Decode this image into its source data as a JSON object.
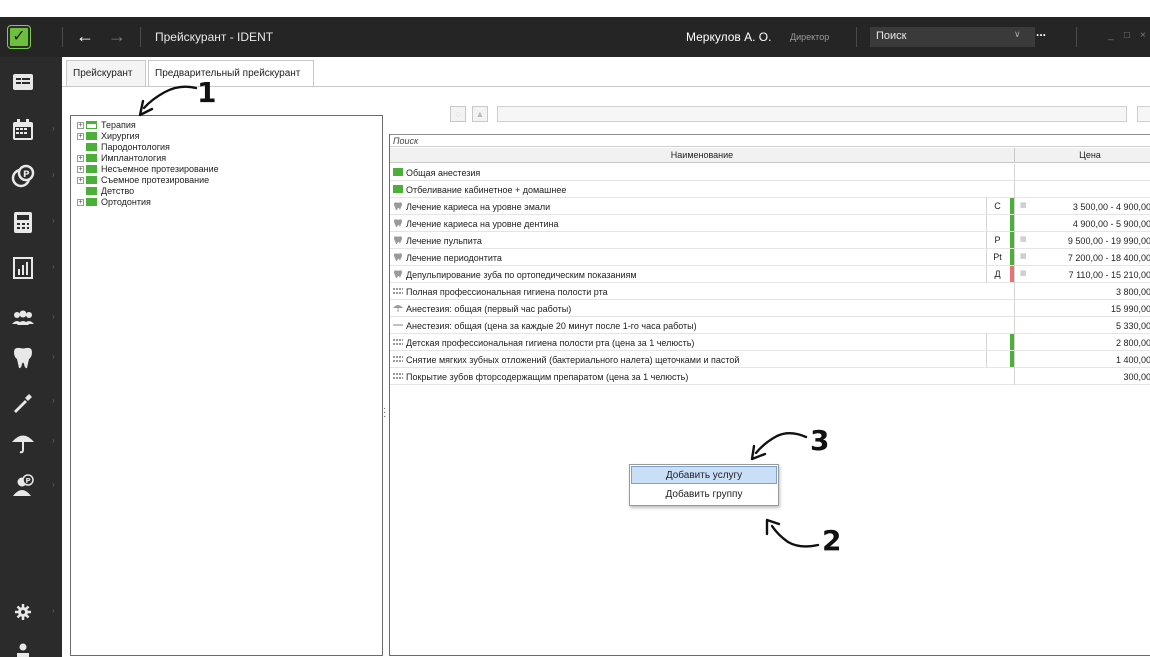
{
  "titlebar": {
    "title": "Прейскурант - IDENT",
    "user_name": "Меркулов А. О.",
    "user_role": "Директор",
    "search_value": "Поиск",
    "more": "...",
    "minimize": "_",
    "maximize": "□",
    "close": "×"
  },
  "sidebar": {
    "items": [
      "registry-icon",
      "calendar-icon",
      "finance-icon",
      "calculator-icon",
      "reports-icon",
      "patients-icon",
      "tooth-icon",
      "tools-icon",
      "umbrella-icon",
      "admin-icon"
    ],
    "bottom": [
      "settings-icon",
      "user-icon"
    ]
  },
  "tabs": [
    {
      "label": "Прейскурант",
      "active": false
    },
    {
      "label": "Предварительный прейскурант",
      "active": true
    }
  ],
  "tree": [
    {
      "label": "Терапия",
      "expander": "+",
      "open": true
    },
    {
      "label": "Хирургия",
      "expander": "+",
      "open": false
    },
    {
      "label": "Пародонтология",
      "expander": "",
      "open": false
    },
    {
      "label": "Имплантология",
      "expander": "+",
      "open": false
    },
    {
      "label": "Несъемное протезирование",
      "expander": "+",
      "open": false
    },
    {
      "label": "Съемное протезирование",
      "expander": "+",
      "open": false
    },
    {
      "label": "Детство",
      "expander": "",
      "open": false
    },
    {
      "label": "Ортодонтия",
      "expander": "+",
      "open": false
    }
  ],
  "list": {
    "search_placeholder": "Поиск",
    "col_name": "Наименование",
    "col_price": "Цена",
    "rows": [
      {
        "icon": "folder",
        "name": "Общая анестезия",
        "code": "",
        "bar": "",
        "price": ""
      },
      {
        "icon": "folder",
        "name": "Отбеливание кабинетное + домашнее",
        "code": "",
        "bar": "",
        "price": ""
      },
      {
        "icon": "tooth",
        "name": "Лечение кариеса на уровне эмали",
        "code": "С",
        "bar": "green",
        "price": "3 500,00 - 4 900,00"
      },
      {
        "icon": "tooth",
        "name": "Лечение  кариеса на уровне дентина",
        "code": "",
        "bar": "green",
        "price": "4 900,00 - 5 900,00"
      },
      {
        "icon": "tooth",
        "name": "Лечение пульпита",
        "code": "Р",
        "bar": "green",
        "price": "9 500,00 - 19 990,00"
      },
      {
        "icon": "tooth",
        "name": "Лечение периодонтита",
        "code": "Pt",
        "bar": "green",
        "price": "7 200,00 - 18 400,00"
      },
      {
        "icon": "tooth",
        "name": "Депульпирование зуба по ортопедическим показаниям",
        "code": "Д",
        "bar": "red",
        "price": "7 110,00 - 15 210,00"
      },
      {
        "icon": "jaw",
        "name": "Полная профессиональная гигиена полости рта",
        "code": "",
        "bar": "",
        "price": "3 800,00"
      },
      {
        "icon": "umbrella",
        "name": "Анестезия: общая (первый час работы)",
        "code": "",
        "bar": "",
        "price": "15 990,00"
      },
      {
        "icon": "line",
        "name": "Анестезия: общая (цена за каждые 20 минут после 1-го часа работы)",
        "code": "",
        "bar": "",
        "price": "5 330,00"
      },
      {
        "icon": "jaw",
        "name": "Детская профессиональная гигиена полости рта (цена за 1 челюсть)",
        "code": "",
        "bar": "green",
        "price": "2 800,00"
      },
      {
        "icon": "jaw",
        "name": "Снятие мягких зубных отложений (бактериального налета) щеточками и пастой",
        "code": "",
        "bar": "green",
        "price": "1 400,00"
      },
      {
        "icon": "jaw",
        "name": "Покрытие зубов фторсодержащим препаратом (цена за 1 челюсть)",
        "code": "",
        "bar": "",
        "price": "300,00"
      }
    ]
  },
  "context_menu": {
    "add_service": "Добавить услугу",
    "add_group": "Добавить группу"
  },
  "annotations": {
    "label_1": "1",
    "label_2": "2",
    "label_3": "3"
  },
  "colors": {
    "accent_green": "#4caf3a",
    "status_red": "#e57373",
    "titlebar": "#252525",
    "sidebar": "#2b2b2b"
  }
}
